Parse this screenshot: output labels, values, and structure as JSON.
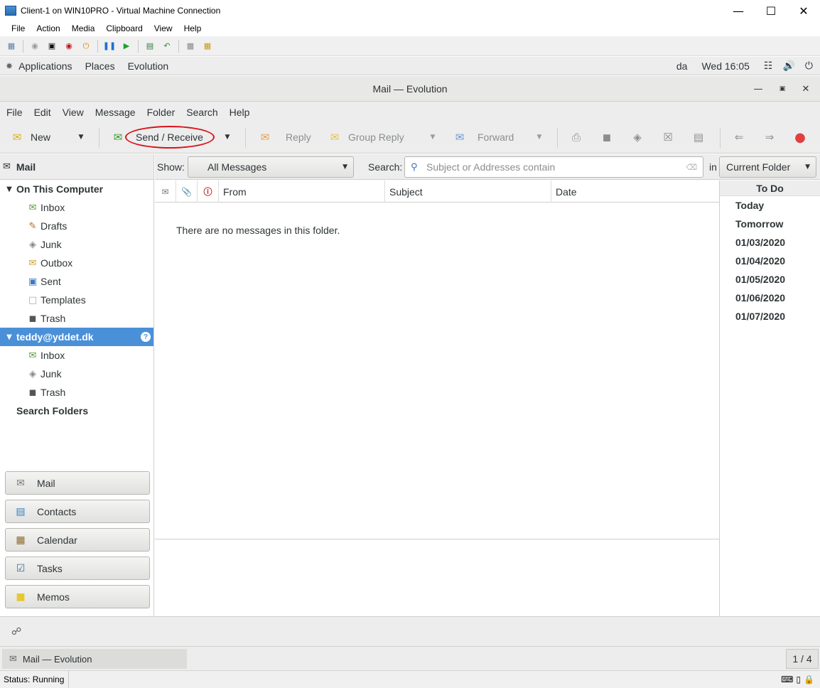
{
  "host": {
    "window_title": "Client-1 on WIN10PRO - Virtual Machine Connection",
    "menu": [
      "File",
      "Action",
      "Media",
      "Clipboard",
      "View",
      "Help"
    ],
    "status_text": "Status: Running"
  },
  "gnome": {
    "menu": [
      "Applications",
      "Places",
      "Evolution"
    ],
    "keyboard_layout": "da",
    "clock": "Wed 16:05",
    "taskbar_item": "Mail — Evolution",
    "workspace": "1 / 4"
  },
  "evolution": {
    "window_title": "Mail — Evolution",
    "menu": [
      "File",
      "Edit",
      "View",
      "Message",
      "Folder",
      "Search",
      "Help"
    ],
    "toolbar": {
      "new": "New",
      "send_receive": "Send / Receive",
      "reply": "Reply",
      "group_reply": "Group Reply",
      "forward": "Forward"
    },
    "sidebar": {
      "header": "Mail",
      "local": {
        "label": "On This Computer",
        "folders": [
          "Inbox",
          "Drafts",
          "Junk",
          "Outbox",
          "Sent",
          "Templates",
          "Trash"
        ]
      },
      "account": {
        "label": "teddy@yddet.dk",
        "folders": [
          "Inbox",
          "Junk",
          "Trash"
        ]
      },
      "search_folders": "Search Folders"
    },
    "switcher": [
      "Mail",
      "Contacts",
      "Calendar",
      "Tasks",
      "Memos"
    ],
    "filter": {
      "show_label": "Show:",
      "show_value": "All Messages",
      "search_label": "Search:",
      "search_placeholder": "Subject or Addresses contain",
      "in_label": "in",
      "scope_value": "Current Folder"
    },
    "columns": {
      "from": "From",
      "subject": "Subject",
      "date": "Date"
    },
    "empty_message": "There are no messages in this folder.",
    "todo": {
      "header": "To Do",
      "days": [
        "Today",
        "Tomorrow",
        "01/03/2020",
        "01/04/2020",
        "01/05/2020",
        "01/06/2020",
        "01/07/2020"
      ]
    }
  },
  "colors": {
    "selection": "#4a90d9",
    "annotation": "#d8141a"
  }
}
